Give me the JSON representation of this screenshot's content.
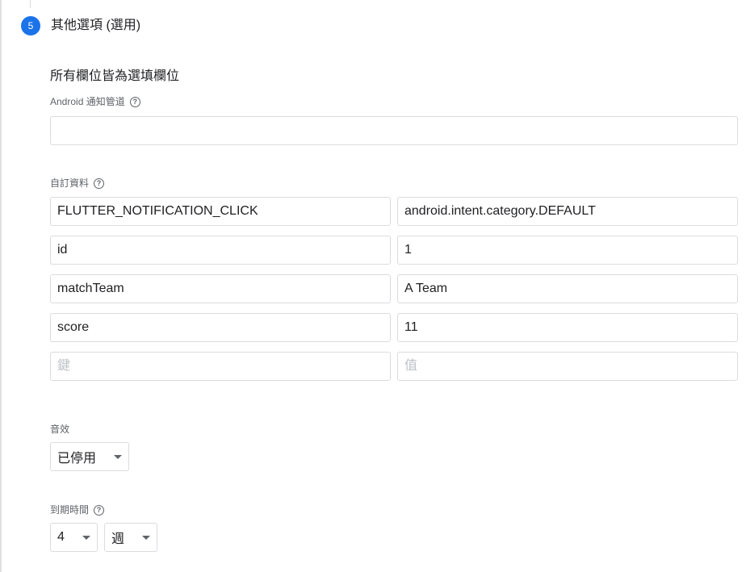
{
  "step": {
    "number": "5",
    "title": "其他選項 (選用)"
  },
  "subtitle": "所有欄位皆為選填欄位",
  "android_channel": {
    "label": "Android 通知管道",
    "value": "",
    "placeholder": ""
  },
  "custom_data": {
    "label": "自訂資料",
    "rows": [
      {
        "key": "FLUTTER_NOTIFICATION_CLICK",
        "value": "android.intent.category.DEFAULT"
      },
      {
        "key": "id",
        "value": "1"
      },
      {
        "key": "matchTeam",
        "value": "A Team"
      },
      {
        "key": "score",
        "value": "11"
      },
      {
        "key": "",
        "value": ""
      }
    ],
    "key_placeholder": "鍵",
    "value_placeholder": "值"
  },
  "sound": {
    "label": "音效",
    "selected": "已停用"
  },
  "expiration": {
    "label": "到期時間",
    "amount": "4",
    "unit": "週"
  },
  "icons": {
    "help": "help-circle-icon",
    "dropdown": "caret-down-icon"
  },
  "colors": {
    "accent": "#1a73e8",
    "border": "#dadce0",
    "label": "#5f6368"
  }
}
